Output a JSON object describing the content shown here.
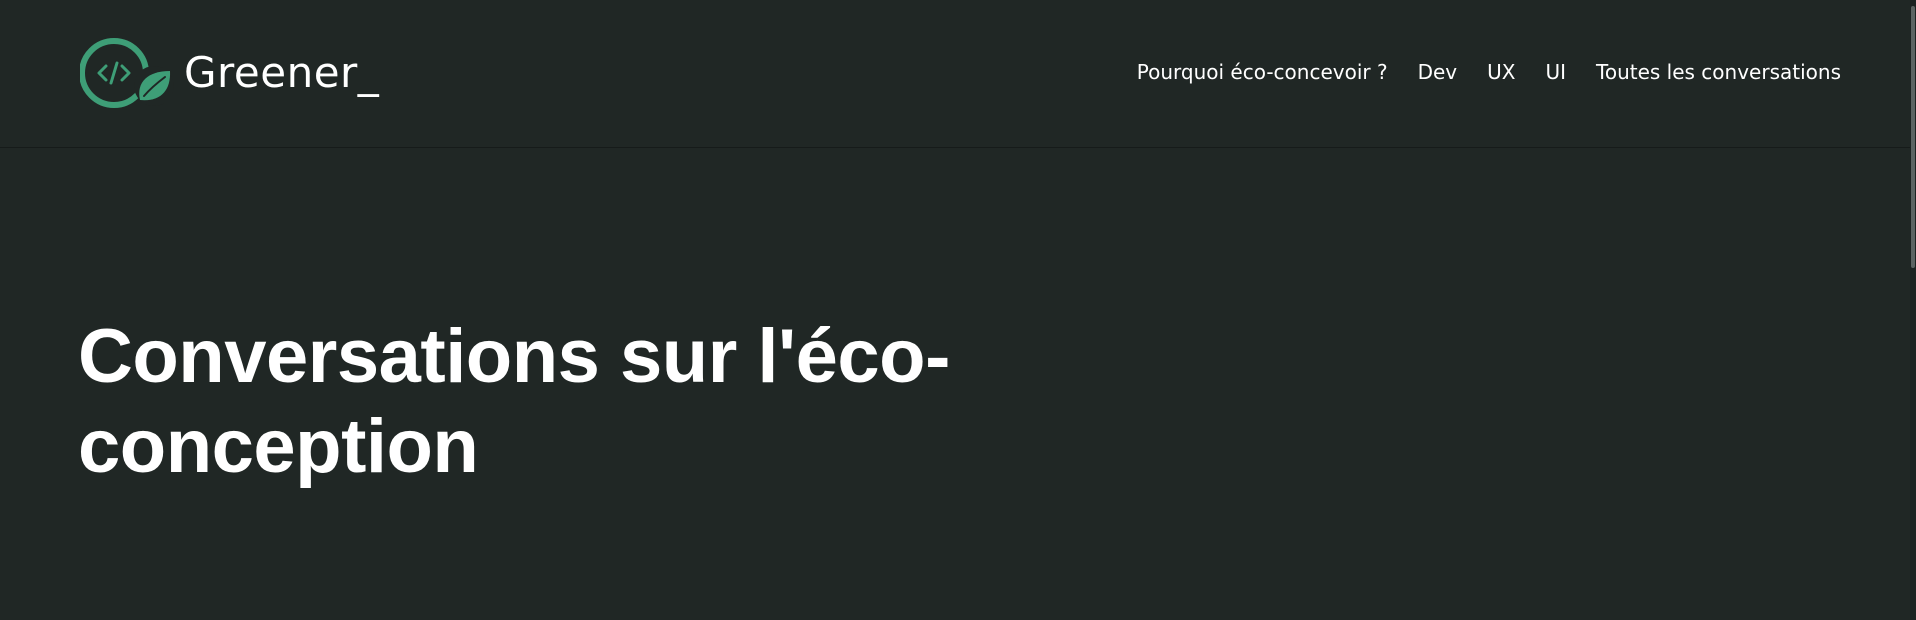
{
  "brand": {
    "name": "Greener_",
    "accent_color": "#3e9e77",
    "logo_icon": "code-leaf-icon"
  },
  "nav": {
    "items": [
      {
        "label": "Pourquoi éco-concevoir ?"
      },
      {
        "label": "Dev"
      },
      {
        "label": "UX"
      },
      {
        "label": "UI"
      },
      {
        "label": "Toutes les conversations"
      }
    ]
  },
  "hero": {
    "title": "Conversations sur l'éco-conception"
  },
  "colors": {
    "background": "#202725",
    "text": "#ffffff"
  }
}
